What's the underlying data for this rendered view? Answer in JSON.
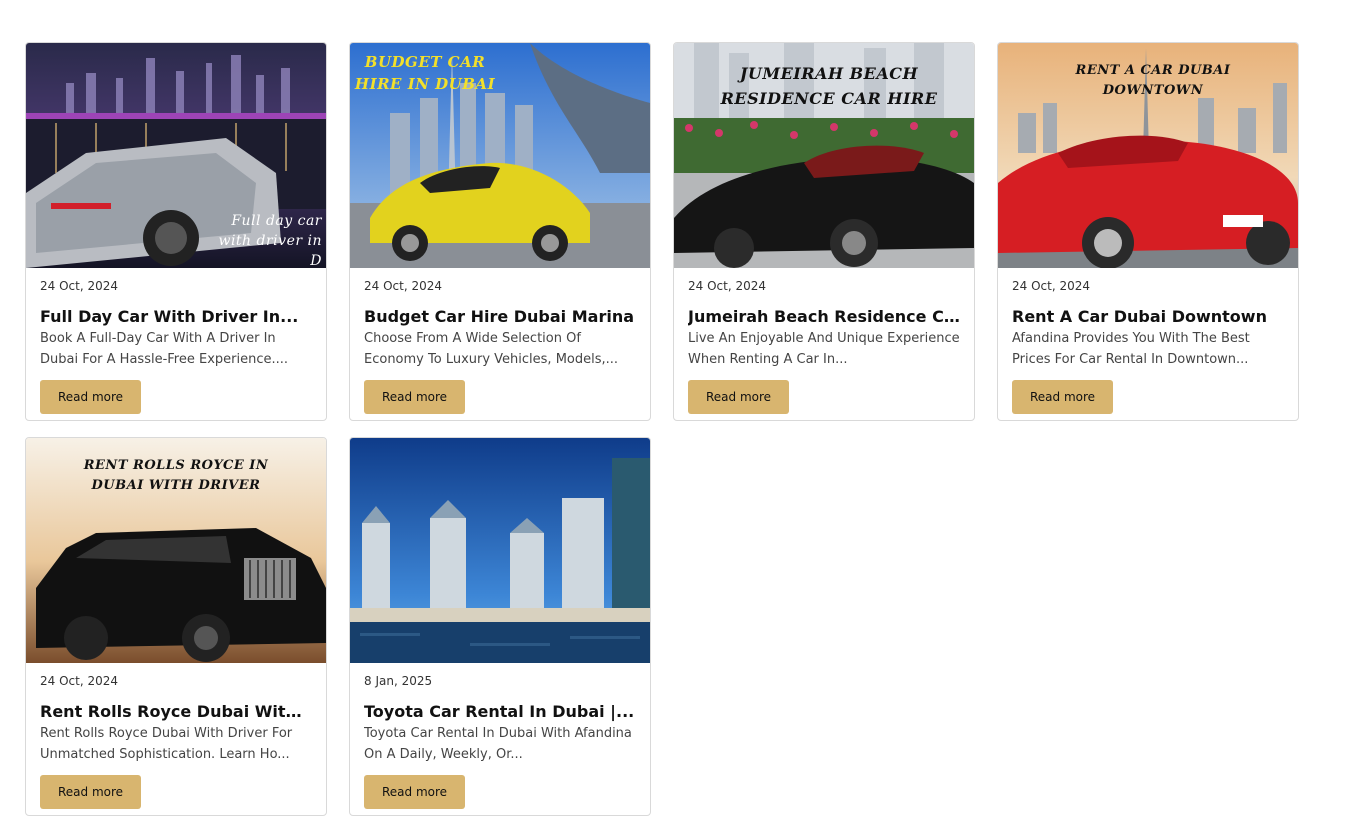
{
  "posts": [
    {
      "date": "24 Oct, 2024",
      "title": "Full Day Car With Driver In...",
      "excerpt": "Book A Full-Day Car With A Driver In Dubai For A Hassle-Free Experience....",
      "button": "Read more",
      "image_text": "Full day car with driver in D"
    },
    {
      "date": "24 Oct, 2024",
      "title": "Budget Car Hire Dubai Marina",
      "excerpt": "Choose From A Wide Selection Of Economy To Luxury Vehicles, Models,...",
      "button": "Read more",
      "image_text": "BUDGET CAR HIRE IN DUBAI"
    },
    {
      "date": "24 Oct, 2024",
      "title": "Jumeirah Beach Residence C...",
      "excerpt": "Live An Enjoyable And Unique Experience When Renting A Car In...",
      "button": "Read more",
      "image_text": "JUMEIRAH BEACH RESIDENCE CAR HIRE"
    },
    {
      "date": "24 Oct, 2024",
      "title": "Rent A Car Dubai Downtown",
      "excerpt": "Afandina Provides You With The Best Prices For Car Rental In Downtown...",
      "button": "Read more",
      "image_text": "RENT A CAR DUBAI DOWNTOWN"
    },
    {
      "date": "24 Oct, 2024",
      "title": "Rent Rolls Royce Dubai With...",
      "excerpt": "Rent Rolls Royce Dubai With Driver For Unmatched Sophistication. Learn Ho...",
      "button": "Read more",
      "image_text": "RENT ROLLS ROYCE IN DUBAI WITH DRIVER"
    },
    {
      "date": "8 Jan, 2025",
      "title": "Toyota Car Rental In Dubai |...",
      "excerpt": "Toyota Car Rental In Dubai With Afandina On A Daily, Weekly, Or...",
      "button": "Read more",
      "image_text": ""
    }
  ],
  "colors": {
    "button_bg": "#d8b56f",
    "border": "#d9d9d9"
  }
}
